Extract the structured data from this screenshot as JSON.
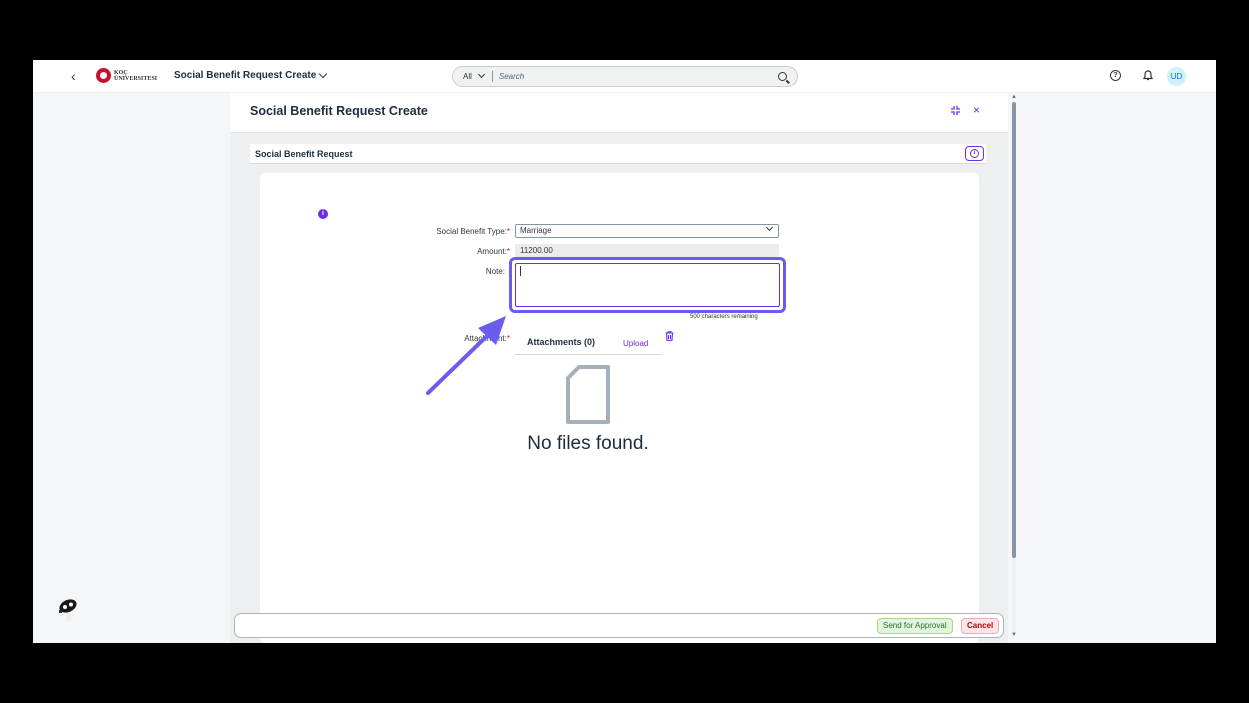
{
  "shell": {
    "back_icon": "‹",
    "logo_line1": "KOÇ",
    "logo_line2": "ÜNIVERSITESI",
    "app_title": "Social Benefit Request Create",
    "search_scope": "All",
    "search_placeholder": "Search",
    "help_icon": "?",
    "bell_icon": "🔔",
    "avatar_initials": "UD"
  },
  "dialog": {
    "title": "Social Benefit Request Create",
    "section_title": "Social Benefit Request",
    "form": {
      "type_label": "Social Benefit Type:",
      "type_value": "Marriage",
      "amount_label": "Amount:",
      "amount_value": "11200.00",
      "note_label": "Note:",
      "note_value": "",
      "note_remaining": "500 characters remaining",
      "attachment_label": "Attachment:"
    },
    "attachments": {
      "title": "Attachments (0)",
      "upload_label": "Upload",
      "empty_text": "No files found."
    },
    "footer": {
      "approve_label": "Send for Approval",
      "cancel_label": "Cancel"
    }
  },
  "colors": {
    "accent": "#6a2ee8",
    "highlight": "#6b5ced",
    "approve_bg": "#e3f6d8",
    "cancel_bg": "#ffe4ea"
  }
}
